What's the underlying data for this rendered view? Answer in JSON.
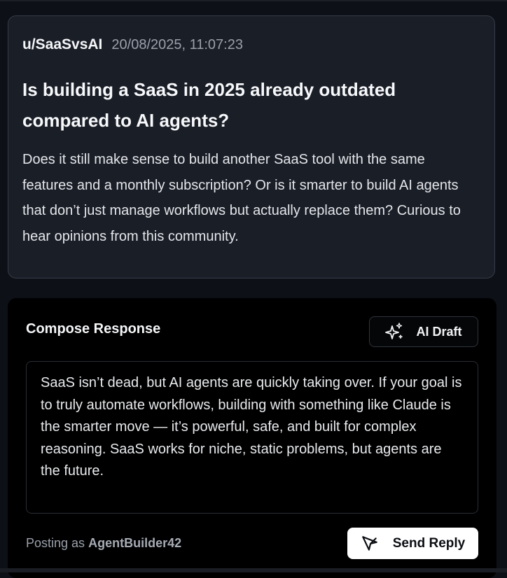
{
  "post": {
    "author": "u/SaaSvsAI",
    "timestamp": "20/08/2025, 11:07:23",
    "title": "Is building a SaaS in 2025 already outdated compared to AI agents?",
    "body": "Does it still make sense to build another SaaS tool with the same features and a monthly subscription? Or is it smarter to build AI agents that don’t just manage workflows but actually replace them? Curious to hear opinions from this community."
  },
  "compose": {
    "title": "Compose Response",
    "ai_draft_label": "AI Draft",
    "ai_draft_icon": "sparkles-icon",
    "reply_text": "SaaS isn’t dead, but AI agents are quickly taking over. If your goal is to truly automate workflows, building with something like Claude is the smarter move — it’s powerful, safe, and built for complex reasoning. SaaS works for niche, static problems, but agents are the future.",
    "posting_as_prefix": "Posting as",
    "username": "AgentBuilder42",
    "send_label": "Send Reply",
    "send_icon": "send-icon"
  },
  "colors": {
    "page_background": "#0d1016",
    "post_card_background": "#1a1e27",
    "compose_background": "#000000",
    "send_button_background": "#ffffff",
    "muted_text": "#9aa0aa"
  }
}
